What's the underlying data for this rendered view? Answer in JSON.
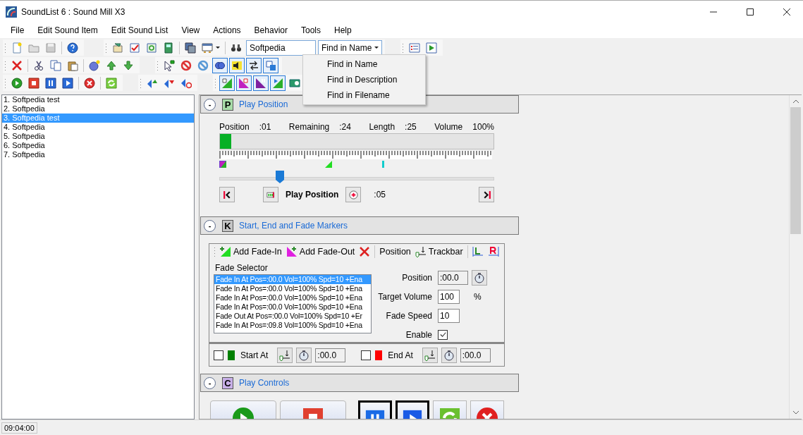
{
  "window": {
    "title": "SoundList 6 : Sound Mill X3"
  },
  "menu": [
    "File",
    "Edit Sound Item",
    "Edit Sound List",
    "View",
    "Actions",
    "Behavior",
    "Tools",
    "Help"
  ],
  "search": {
    "value": "Softpedia"
  },
  "search_scope": {
    "value": "Find in Name",
    "options": [
      {
        "label": "Find in Name"
      },
      {
        "label": "Find in Description"
      },
      {
        "label": "Find in Filename"
      }
    ]
  },
  "sound_list": [
    {
      "label": "1. Softpedia test",
      "selected": false
    },
    {
      "label": "2. Softpedia",
      "selected": false
    },
    {
      "label": "3. Softpedia test",
      "selected": true
    },
    {
      "label": "4. Softpedia",
      "selected": false
    },
    {
      "label": "5. Softpedia",
      "selected": false
    },
    {
      "label": "6. Softpedia",
      "selected": false
    },
    {
      "label": "7. Softpedia",
      "selected": false
    }
  ],
  "play_position": {
    "collapse": "-",
    "letter": "P",
    "title": "Play Position",
    "stats": [
      {
        "label": "Position",
        "value": ":01"
      },
      {
        "label": "Remaining",
        "value": ":24"
      },
      {
        "label": "Length",
        "value": ":25"
      },
      {
        "label": "Volume",
        "value": "100%"
      }
    ],
    "progress": {
      "level": 0.04
    },
    "slider": {
      "level": 0.22
    },
    "caption": "Play Position",
    "step": ":05"
  },
  "markers": {
    "collapse": "-",
    "letter": "K",
    "title": "Start, End and Fade Markers",
    "toolbar": [
      "Add Fade-In",
      "Add Fade-Out",
      "Position",
      "Trackbar"
    ],
    "selector_label": "Fade Selector",
    "fades": [
      {
        "label": "Fade In At Pos=:00.0 Vol=100% Spd=10 +Ena",
        "selected": true
      },
      {
        "label": "Fade In At Pos=:00.0 Vol=100% Spd=10 +Ena",
        "selected": false
      },
      {
        "label": "Fade In At Pos=:00.0 Vol=100% Spd=10 +Ena",
        "selected": false
      },
      {
        "label": "Fade In At Pos=:00.0 Vol=100% Spd=10 +Ena",
        "selected": false
      },
      {
        "label": "Fade Out At Pos=:00.0 Vol=100% Spd=10 +Er",
        "selected": false
      },
      {
        "label": "Fade In At Pos=:09.8 Vol=100% Spd=10 +Ena",
        "selected": false
      }
    ],
    "fields": [
      {
        "label": "Position",
        "value": ":00.0",
        "kind": "readonly"
      },
      {
        "label": "Target Volume",
        "value": "100",
        "unit": "%",
        "kind": "input"
      },
      {
        "label": "Fade Speed",
        "value": "10",
        "kind": "input"
      }
    ],
    "enable": {
      "label": "Enable",
      "checked": true
    },
    "start": {
      "label": "Start At",
      "checked": false,
      "value": ":00.0"
    },
    "end": {
      "label": "End At",
      "checked": false,
      "value": ":00.0"
    }
  },
  "play_controls": {
    "collapse": "-",
    "letter": "C",
    "title": "Play Controls"
  },
  "status_bar": {
    "time": "09:04:00"
  }
}
